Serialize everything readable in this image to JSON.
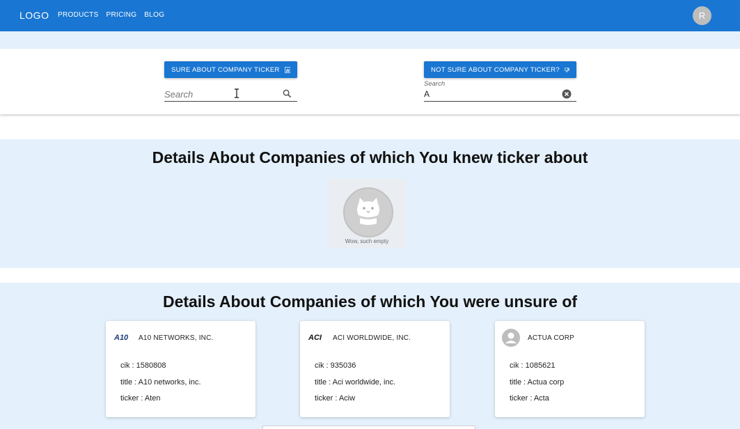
{
  "appbar": {
    "logo": "LOGO",
    "nav": [
      "PRODUCTS",
      "PRICING",
      "BLOG"
    ],
    "avatar_initial": "R"
  },
  "search": {
    "sure_button_label": "SURE ABOUT COMPANY TICKER",
    "sure_placeholder": "Search",
    "not_sure_button_label": "NOT SURE ABOUT COMPANY TICKER?",
    "not_sure_label": "Search",
    "not_sure_value": "A"
  },
  "known_section": {
    "title": "Details About Companies of which You knew ticker about",
    "empty_text": "Wow, such empty"
  },
  "unsure_section": {
    "title": "Details About Companies of which You were unsure of",
    "cards": [
      {
        "logo_text": "A10",
        "name": "A10 NETWORKS, INC.",
        "cik": "cik : 1580808",
        "title": "title : A10 networks, inc.",
        "ticker": "ticker : Aten"
      },
      {
        "logo_text": "ACI",
        "name": "ACI WORLDWIDE, INC.",
        "cik": "cik : 935036",
        "title": "title : Aci worldwide, inc.",
        "ticker": "ticker : Aciw"
      },
      {
        "logo_text": "",
        "name": "ACTUA CORP",
        "cik": "cik : 1085621",
        "title": "title : Actua corp",
        "ticker": "ticker : Acta"
      }
    ]
  },
  "colors": {
    "primary": "#1976d2",
    "band": "#e4f0fb"
  }
}
